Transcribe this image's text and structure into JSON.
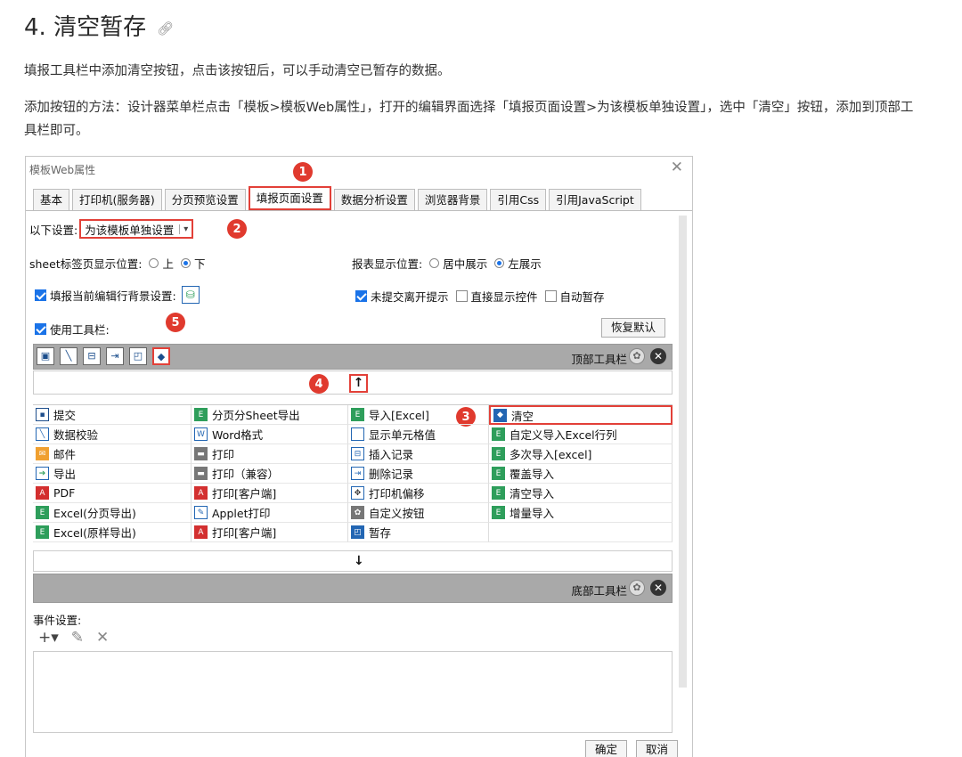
{
  "heading": {
    "title": "4. 清空暂存",
    "anchor_icon": "link-icon"
  },
  "paragraphs": [
    "填报工具栏中添加清空按钮，点击该按钮后，可以手动清空已暂存的数据。",
    "添加按钮的方法：设计器菜单栏点击「模板>模板Web属性」，打开的编辑界面选择「填报页面设置>为该模板单独设置」，选中「清空」按钮，添加到顶部工具栏即可。"
  ],
  "dialog": {
    "title": "模板Web属性",
    "tabs": [
      "基本",
      "打印机(服务器)",
      "分页预览设置",
      "填报页面设置",
      "数据分析设置",
      "浏览器背景",
      "引用Css",
      "引用JavaScript"
    ],
    "active_tab_index": 3,
    "settings_label": "以下设置:",
    "settings_value": "为该模板单独设置",
    "sheet_label": "sheet标签页显示位置:",
    "sheet_top": "上",
    "sheet_bottom": "下",
    "report_label": "报表显示位置:",
    "report_center": "居中展示",
    "report_left": "左展示",
    "fill_bg_label": "填报当前编辑行背景设置:",
    "unsubmitted_label": "未提交离开提示",
    "direct_show_label": "直接显示控件",
    "auto_save_label": "自动暂存",
    "use_toolbar_label": "使用工具栏:",
    "restore_default": "恢复默认",
    "top_toolbar_label": "顶部工具栏",
    "bottom_toolbar_label": "底部工具栏",
    "event_label": "事件设置:",
    "ok": "确定",
    "cancel": "取消",
    "badges": [
      "1",
      "2",
      "3",
      "4",
      "5"
    ],
    "button_grid": [
      [
        "提交",
        "分页分Sheet导出",
        "导入[Excel]",
        "清空"
      ],
      [
        "数据校验",
        "Word格式",
        "显示单元格值",
        "自定义导入Excel行列"
      ],
      [
        "邮件",
        "打印",
        "插入记录",
        "多次导入[excel]"
      ],
      [
        "导出",
        "打印（兼容）",
        "删除记录",
        "覆盖导入"
      ],
      [
        "PDF",
        "打印[客户端]",
        "打印机偏移",
        "清空导入"
      ],
      [
        "Excel(分页导出)",
        "Applet打印",
        "自定义按钮",
        "增量导入"
      ],
      [
        "Excel(原样导出)",
        "打印[客户端]",
        "暂存",
        ""
      ]
    ]
  }
}
